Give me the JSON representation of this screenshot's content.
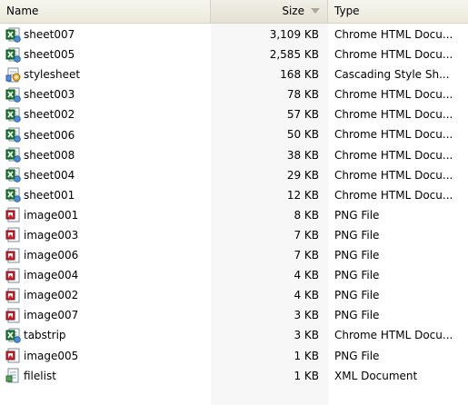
{
  "columns": {
    "name": "Name",
    "size": "Size",
    "type": "Type"
  },
  "colors": {
    "header_bg": "#ebeadb",
    "sorted_column_bg": "#f7f7f7",
    "excel_green": "#1e7b34",
    "png_red": "#c8232c"
  },
  "files": [
    {
      "name": "sheet007",
      "size": "3,109 KB",
      "type": "Chrome HTML Docu...",
      "icon": "excel-html-icon"
    },
    {
      "name": "sheet005",
      "size": "2,585 KB",
      "type": "Chrome HTML Docu...",
      "icon": "excel-html-icon"
    },
    {
      "name": "stylesheet",
      "size": "168 KB",
      "type": "Cascading Style Sh...",
      "icon": "stylesheet-icon"
    },
    {
      "name": "sheet003",
      "size": "78 KB",
      "type": "Chrome HTML Docu...",
      "icon": "excel-html-icon"
    },
    {
      "name": "sheet002",
      "size": "57 KB",
      "type": "Chrome HTML Docu...",
      "icon": "excel-html-icon"
    },
    {
      "name": "sheet006",
      "size": "50 KB",
      "type": "Chrome HTML Docu...",
      "icon": "excel-html-icon"
    },
    {
      "name": "sheet008",
      "size": "38 KB",
      "type": "Chrome HTML Docu...",
      "icon": "excel-html-icon"
    },
    {
      "name": "sheet004",
      "size": "29 KB",
      "type": "Chrome HTML Docu...",
      "icon": "excel-html-icon"
    },
    {
      "name": "sheet001",
      "size": "12 KB",
      "type": "Chrome HTML Docu...",
      "icon": "excel-html-icon"
    },
    {
      "name": "image001",
      "size": "8 KB",
      "type": "PNG File",
      "icon": "png-image-icon"
    },
    {
      "name": "image003",
      "size": "7 KB",
      "type": "PNG File",
      "icon": "png-image-icon"
    },
    {
      "name": "image006",
      "size": "7 KB",
      "type": "PNG File",
      "icon": "png-image-icon"
    },
    {
      "name": "image004",
      "size": "4 KB",
      "type": "PNG File",
      "icon": "png-image-icon"
    },
    {
      "name": "image002",
      "size": "4 KB",
      "type": "PNG File",
      "icon": "png-image-icon"
    },
    {
      "name": "image007",
      "size": "3 KB",
      "type": "PNG File",
      "icon": "png-image-icon"
    },
    {
      "name": "tabstrip",
      "size": "3 KB",
      "type": "Chrome HTML Docu...",
      "icon": "excel-html-icon"
    },
    {
      "name": "image005",
      "size": "1 KB",
      "type": "PNG File",
      "icon": "png-image-icon"
    },
    {
      "name": "filelist",
      "size": "1 KB",
      "type": "XML Document",
      "icon": "xml-document-icon"
    }
  ]
}
